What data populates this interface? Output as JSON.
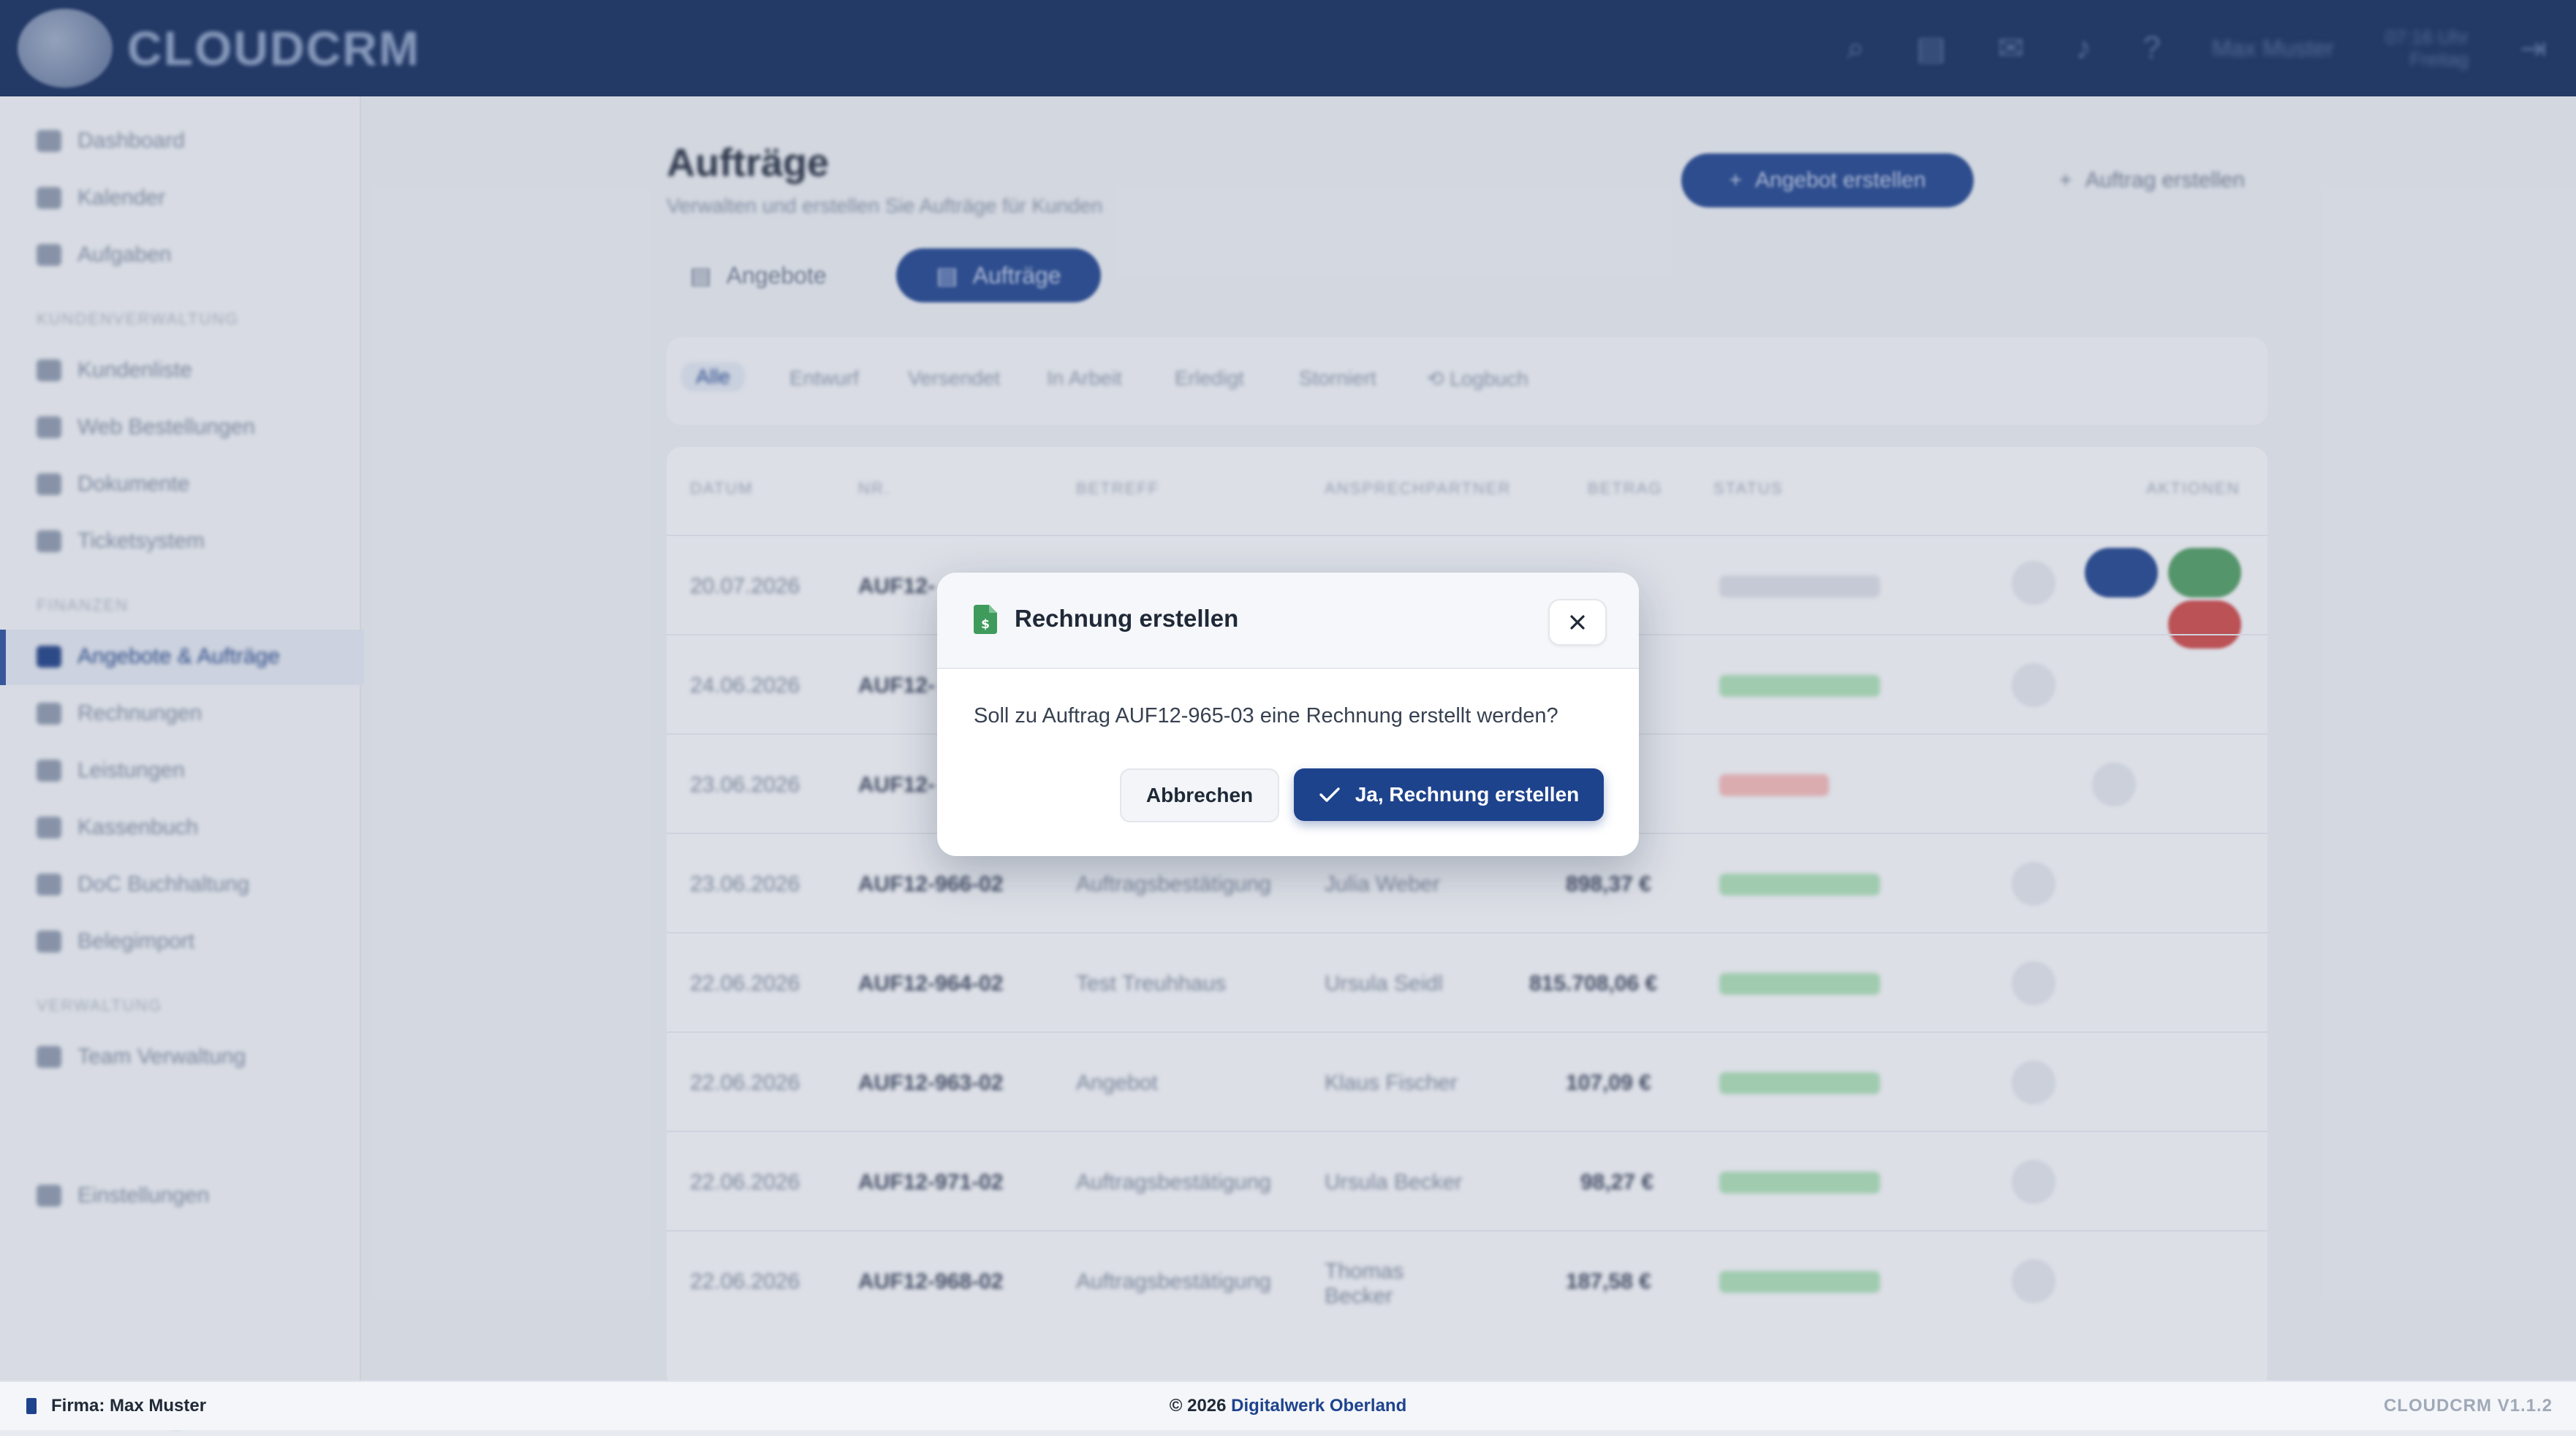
{
  "app": {
    "brand": "CLOUDCRM",
    "user_name": "Max Muster",
    "clock_time": "07:16 Uhr",
    "clock_date": "Freitag"
  },
  "sidebar": {
    "items": [
      {
        "label": "Dashboard"
      },
      {
        "label": "Kalender"
      },
      {
        "label": "Aufgaben"
      },
      {
        "label": "Kundenliste"
      },
      {
        "label": "Web Bestellungen"
      },
      {
        "label": "Dokumente"
      },
      {
        "label": "Ticketsystem"
      },
      {
        "label": "Angebote & Aufträge"
      },
      {
        "label": "Rechnungen"
      },
      {
        "label": "Leistungen"
      },
      {
        "label": "Kassenbuch"
      },
      {
        "label": "DoC Buchhaltung"
      },
      {
        "label": "Belegimport"
      },
      {
        "label": "Team Verwaltung"
      },
      {
        "label": "Einstellungen"
      }
    ],
    "sections": [
      "KUNDENVERWALTUNG",
      "FINANZEN",
      "VERWALTUNG"
    ],
    "collapse_glyph": "«"
  },
  "page": {
    "title": "Aufträge",
    "subtitle": "Verwalten und erstellen Sie Aufträge für Kunden",
    "btn_create_offer": "Angebot erstellen",
    "btn_create_order": "Auftrag erstellen",
    "tab_offers": "Angebote",
    "tab_orders": "Aufträge",
    "filters": [
      "Alle",
      "Entwurf",
      "Versendet",
      "In Arbeit",
      "Erledigt",
      "Storniert",
      "Logbuch"
    ]
  },
  "table": {
    "headers": [
      "DATUM",
      "NR.",
      "BETREFF",
      "ANSPRECHPARTNER",
      "BETRAG",
      "STATUS",
      "AKTIONEN"
    ],
    "rows": [
      {
        "date": "20.07.2026",
        "nr": "AUF12-",
        "subject": "",
        "contact": "",
        "amount": "",
        "status": "grey"
      },
      {
        "date": "24.06.2026",
        "nr": "AUF12-",
        "subject": "",
        "contact": "",
        "amount": "",
        "status": "green"
      },
      {
        "date": "23.06.2026",
        "nr": "AUF12-",
        "subject": "",
        "contact": "",
        "amount": "",
        "status": "red"
      },
      {
        "date": "23.06.2026",
        "nr": "AUF12-966-02",
        "subject": "Auftragsbestätigung",
        "contact": "Julia Weber",
        "amount": "898,37 €",
        "status": "green"
      },
      {
        "date": "22.06.2026",
        "nr": "AUF12-964-02",
        "subject": "Test Treuhhaus",
        "contact": "Ursula Seidl",
        "amount": "815.708,06 €",
        "status": "green"
      },
      {
        "date": "22.06.2026",
        "nr": "AUF12-963-02",
        "subject": "Angebot",
        "contact": "Klaus Fischer",
        "amount": "107,09 €",
        "status": "green"
      },
      {
        "date": "22.06.2026",
        "nr": "AUF12-971-02",
        "subject": "Auftragsbestätigung",
        "contact": "Ursula Becker",
        "amount": "98,27 €",
        "status": "green"
      },
      {
        "date": "22.06.2026",
        "nr": "AUF12-968-02",
        "subject": "Auftragsbestätigung",
        "contact": "Thomas Becker",
        "amount": "187,58 €",
        "status": "green"
      }
    ]
  },
  "modal": {
    "title": "Rechnung erstellen",
    "message": "Soll zu Auftrag AUF12-965-03 eine Rechnung erstellt werden?",
    "cancel_label": "Abbrechen",
    "confirm_label": "Ja, Rechnung erstellen",
    "icon_color": "#3e9b5c",
    "confirm_color": "#1e438d"
  },
  "footer": {
    "company": "Firma: Max Muster",
    "copyright": "© 2026",
    "vendor": "Digitalwerk Oberland",
    "version": "CLOUDCRM V1.1.2"
  }
}
